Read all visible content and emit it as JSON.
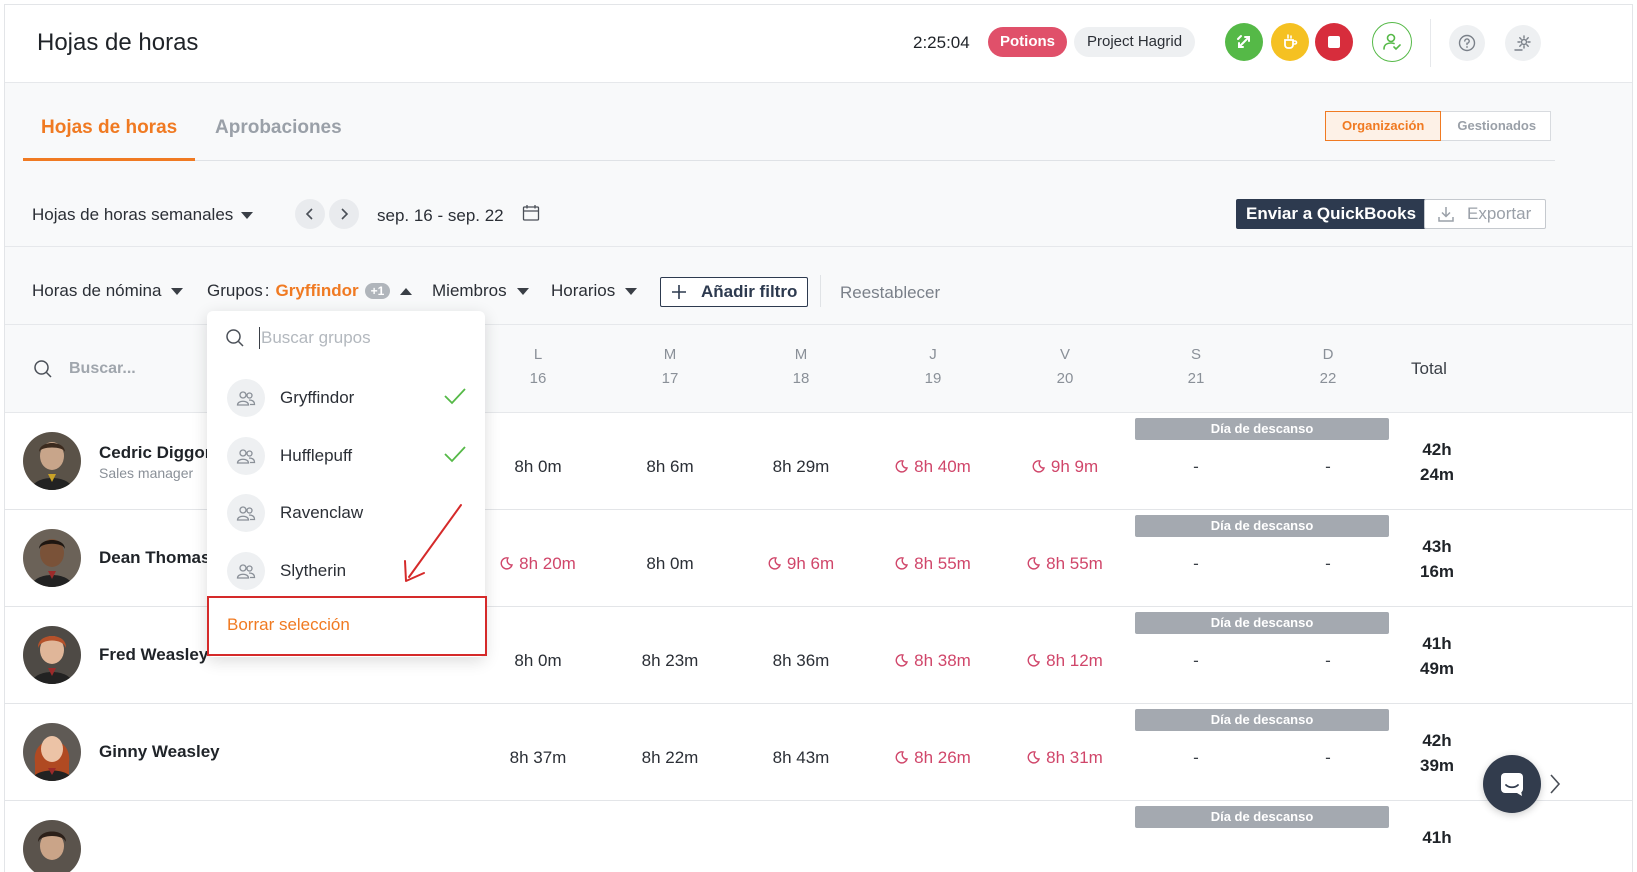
{
  "header": {
    "title": "Hojas de horas",
    "timer": "2:25:04",
    "project": "Potions",
    "task": "Project Hagrid",
    "colors": {
      "project": "#e0506a",
      "switch": "#55b947",
      "break": "#f5c122",
      "stop": "#d72d3c"
    }
  },
  "tabs": [
    {
      "label": "Hojas de horas",
      "active": true
    },
    {
      "label": "Aprobaciones",
      "active": false
    }
  ],
  "scope": {
    "organization": "Organización",
    "managed": "Gestionados",
    "active": "Organización"
  },
  "period": {
    "selector": "Hojas de horas semanales",
    "range": "sep. 16 - sep. 22",
    "quickbooks": "Enviar a QuickBooks",
    "export": "Exportar"
  },
  "filters": {
    "payroll": "Horas de nómina",
    "groups_label": "Grupos",
    "groups_value": "Gryffindor",
    "groups_extra": "+1",
    "members": "Miembros",
    "schedules": "Horarios",
    "add_filter": "Añadir filtro",
    "reset": "Reestablecer"
  },
  "table": {
    "search_placeholder": "Buscar...",
    "days": [
      {
        "letter": "L",
        "num": "16"
      },
      {
        "letter": "M",
        "num": "17"
      },
      {
        "letter": "M",
        "num": "18"
      },
      {
        "letter": "J",
        "num": "19"
      },
      {
        "letter": "V",
        "num": "20"
      },
      {
        "letter": "S",
        "num": "21"
      },
      {
        "letter": "D",
        "num": "22"
      }
    ],
    "total_header": "Total",
    "rest_label": "Día de descanso",
    "rows": [
      {
        "name": "Cedric Diggory",
        "role": "Sales manager",
        "mon": "8h 0m",
        "tue": "8h 6m",
        "wed": "8h 29m",
        "thu": "8h 40m",
        "fri": "9h 9m",
        "sat": "-",
        "sun": "-",
        "total1": "42h",
        "total2": "24m"
      },
      {
        "name": "Dean Thomas",
        "role": "",
        "mon": "8h 20m",
        "tue": "8h 0m",
        "wed": "9h 6m",
        "thu": "8h 55m",
        "fri": "8h 55m",
        "sat": "-",
        "sun": "-",
        "total1": "43h",
        "total2": "16m"
      },
      {
        "name": "Fred Weasley",
        "role": "",
        "mon": "8h 0m",
        "tue": "8h 23m",
        "wed": "8h 36m",
        "thu": "8h 38m",
        "fri": "8h 12m",
        "sat": "-",
        "sun": "-",
        "total1": "41h",
        "total2": "49m"
      },
      {
        "name": "Ginny Weasley",
        "role": "",
        "mon": "8h 37m",
        "tue": "8h 22m",
        "wed": "8h 43m",
        "thu": "8h 26m",
        "fri": "8h 31m",
        "sat": "-",
        "sun": "-",
        "total1": "42h",
        "total2": "39m"
      },
      {
        "name": "",
        "role": "",
        "total1": "41h"
      }
    ]
  },
  "groups_dropdown": {
    "search_placeholder": "Buscar grupos",
    "items": [
      {
        "label": "Gryffindor",
        "selected": true
      },
      {
        "label": "Hufflepuff",
        "selected": true
      },
      {
        "label": "Ravenclaw",
        "selected": false
      },
      {
        "label": "Slytherin",
        "selected": false
      }
    ],
    "clear": "Borrar selección"
  }
}
